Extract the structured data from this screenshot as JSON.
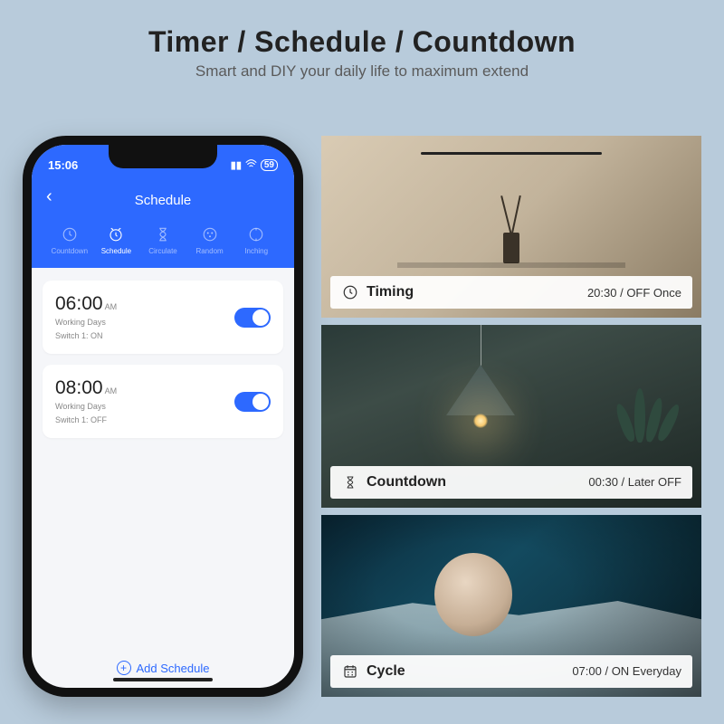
{
  "hero": {
    "title": "Timer / Schedule / Countdown",
    "subtitle": "Smart and DIY your daily life to maximum extend"
  },
  "phone": {
    "status": {
      "time": "15:06",
      "battery": "59"
    },
    "header": {
      "title": "Schedule"
    },
    "tabs": [
      {
        "id": "countdown",
        "label": "Countdown"
      },
      {
        "id": "schedule",
        "label": "Schedule"
      },
      {
        "id": "circulate",
        "label": "Circulate"
      },
      {
        "id": "random",
        "label": "Random"
      },
      {
        "id": "inching",
        "label": "Inching"
      }
    ],
    "schedules": [
      {
        "time": "06:00",
        "ampm": "AM",
        "days": "Working Days",
        "action": "Switch 1: ON",
        "enabled": true
      },
      {
        "time": "08:00",
        "ampm": "AM",
        "days": "Working Days",
        "action": "Switch 1: OFF",
        "enabled": true
      }
    ],
    "add_label": "Add Schedule"
  },
  "panels": [
    {
      "id": "timing",
      "label": "Timing",
      "value": "20:30 / OFF Once"
    },
    {
      "id": "countdown",
      "label": "Countdown",
      "value": "00:30 / Later OFF"
    },
    {
      "id": "cycle",
      "label": "Cycle",
      "value": "07:00 / ON Everyday"
    }
  ]
}
